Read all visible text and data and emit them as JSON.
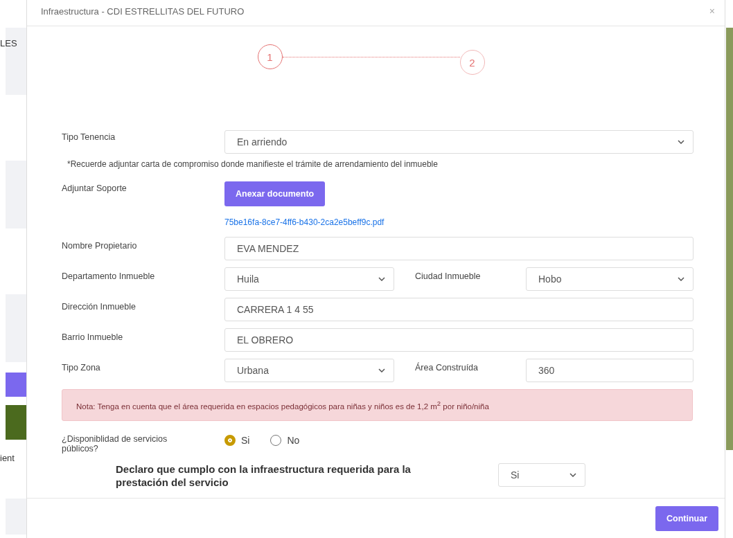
{
  "background": {
    "texts": [
      "LES",
      "ient"
    ]
  },
  "modal": {
    "title": "Infraestructura - CDI ESTRELLITAS DEL FUTURO",
    "close": "×",
    "steps": [
      {
        "label": "1",
        "selected": true
      },
      {
        "label": "2",
        "selected": false
      }
    ],
    "form": {
      "tipo_tenencia": {
        "label": "Tipo Tenencia",
        "value": "En arriendo"
      },
      "note": "*Recuerde adjuntar carta de compromiso donde manifieste el trámite de arrendamiento del inmueble",
      "soporte": {
        "label": "Adjuntar Soporte",
        "button": "Anexar documento",
        "file": "75be16fa-8ce7-4ff6-b430-2ca2e5beff9c.pdf"
      },
      "fields": [
        {
          "kind": "input",
          "label": "Nombre Propietario",
          "value": "EVA MENDEZ"
        },
        {
          "kind": "half-select",
          "label": "Departamento Inmueble",
          "value": "Huila"
        },
        {
          "kind": "half-select",
          "label": "Ciudad Inmueble",
          "value": "Hobo"
        },
        {
          "kind": "input",
          "label": "Dirección Inmueble",
          "value": "CARRERA 1  4 55"
        },
        {
          "kind": "input",
          "label": "Barrio Inmueble",
          "value": "EL OBRERO"
        },
        {
          "kind": "half-select",
          "label": "Tipo Zona",
          "value": "Urbana"
        },
        {
          "kind": "half-input",
          "label": "Área Construída",
          "value": "360"
        }
      ],
      "alert": "Nota: Tenga en cuenta que el área requerida en espacios pedagógicos para niñas y niños es de 1,2 m$^{2}$ por niño/niña",
      "servicios": {
        "label": "¿Disponiblidad de servicios públicos?",
        "options": [
          {
            "label": "Si",
            "selected": true
          },
          {
            "label": "No",
            "selected": false
          }
        ]
      },
      "declaro": {
        "label": "Declaro que cumplo con la infraestructura requerida para la prestación del servicio",
        "value": "Si"
      }
    },
    "footer": {
      "button": "Continuar"
    }
  }
}
